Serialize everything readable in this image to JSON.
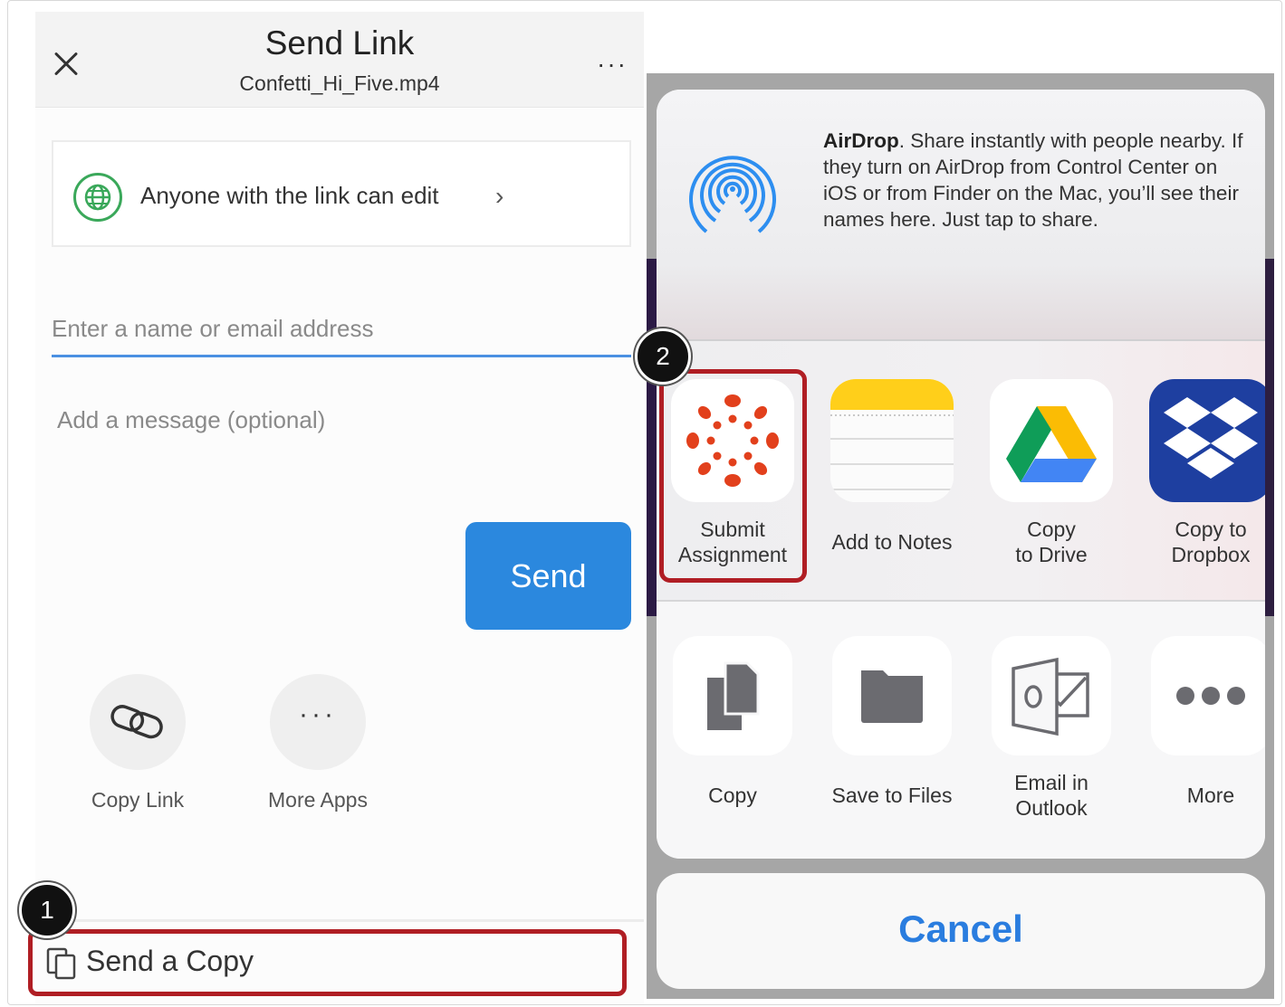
{
  "left": {
    "title": "Send Link",
    "subtitle": "Confetti_Hi_Five.mp4",
    "overflow": "···",
    "permission": "Anyone with the link can edit",
    "chevron": "›",
    "email_placeholder": "Enter a name or email address",
    "message_placeholder": "Add a message (optional)",
    "send_label": "Send",
    "actions": [
      {
        "label": "Copy Link"
      },
      {
        "label": "More Apps"
      }
    ],
    "more_dots": "···",
    "send_copy_label": "Send a Copy",
    "step_badge": "1"
  },
  "right": {
    "airdrop_title": "AirDrop",
    "airdrop_text": ". Share instantly with people nearby. If they turn on AirDrop from Control Center on iOS or from Finder on the Mac, you’ll see their names here. Just tap to share.",
    "apps": [
      {
        "label_1": "Submit",
        "label_2": "Assignment"
      },
      {
        "label_1": "Add to Notes",
        "label_2": ""
      },
      {
        "label_1": "Copy",
        "label_2": "to Drive"
      },
      {
        "label_1": "Copy to",
        "label_2": "Dropbox"
      }
    ],
    "actions": [
      {
        "label_1": "Copy",
        "label_2": ""
      },
      {
        "label_1": "Save to Files",
        "label_2": ""
      },
      {
        "label_1": "Email in",
        "label_2": "Outlook"
      },
      {
        "label_1": "More",
        "label_2": ""
      }
    ],
    "cancel_label": "Cancel",
    "step_badge": "2"
  },
  "colors": {
    "accent_blue": "#2b88de",
    "cancel_blue": "#2a7ddf",
    "highlight_red": "#b01e24",
    "canvas_red": "#e2401c",
    "globe_green": "#3aa85a"
  }
}
